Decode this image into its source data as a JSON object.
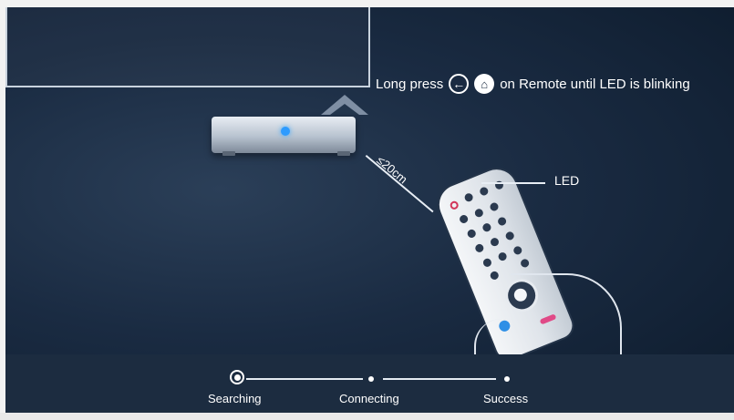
{
  "instruction": {
    "prefix": "Long press",
    "back_icon": "←",
    "home_icon": "⌂",
    "suffix": "on Remote until LED is blinking"
  },
  "diagram": {
    "distance_label": "≤20cm",
    "led_label": "LED"
  },
  "steps": [
    {
      "label": "Searching",
      "state": "active"
    },
    {
      "label": "Connecting",
      "state": "pending"
    },
    {
      "label": "Success",
      "state": "pending"
    }
  ],
  "colors": {
    "background": "#1a2b42",
    "bottom_bar": "#1c2c40",
    "box_led": "#2d9bff",
    "text": "#ffffff"
  }
}
